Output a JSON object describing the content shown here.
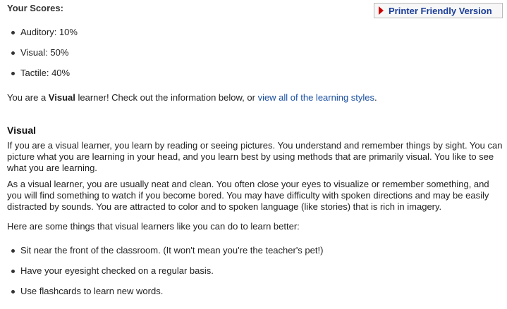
{
  "scores": {
    "heading": "Your Scores:",
    "items": [
      "Auditory: 10%",
      "Visual: 50%",
      "Tactile: 40%"
    ]
  },
  "printer_button": {
    "label": "Printer Friendly Version",
    "arrow_color": "#cc0000"
  },
  "result": {
    "prefix": "You are a ",
    "style": "Visual",
    "middle": " learner! Check out the information below, or ",
    "link": "view all of the learning styles",
    "suffix": "."
  },
  "section": {
    "title": "Visual",
    "paragraphs": [
      "If you are a visual learner, you learn by reading or seeing pictures. You understand and remember things by sight. You can picture what you are learning in your head, and you learn best by using methods that are primarily visual. You like to see what you are learning.",
      "As a visual learner, you are usually neat and clean. You often close your eyes to visualize or remember something, and you will find something to watch if you become bored. You may have difficulty with spoken directions and may be easily distracted by sounds. You are attracted to color and to spoken language (like stories) that is rich in imagery.",
      "Here are some things that visual learners like you can do to learn better:"
    ],
    "tips": [
      "Sit near the front of the classroom. (It won't mean you're the teacher's pet!)",
      "Have your eyesight checked on a regular basis.",
      "Use flashcards to learn new words."
    ]
  },
  "colors": {
    "link": "#1a4fa0",
    "button_text": "#1a3d99"
  }
}
